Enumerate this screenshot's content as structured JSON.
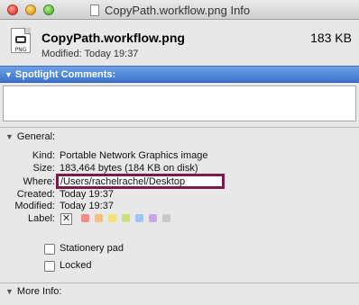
{
  "window": {
    "title": "CopyPath.workflow.png Info"
  },
  "file": {
    "name": "CopyPath.workflow.png",
    "size": "183 KB",
    "modified": "Modified: Today 19:37",
    "icon_label": "PNG"
  },
  "spotlight": {
    "header": "Spotlight Comments:"
  },
  "general": {
    "header": "General:",
    "kind_label": "Kind:",
    "kind_value": "Portable Network Graphics image",
    "size_label": "Size:",
    "size_value": "183,464 bytes (184 KB on disk)",
    "where_label": "Where:",
    "where_value": "/Users/rachelrachel/Desktop",
    "created_label": "Created:",
    "created_value": "Today 19:37",
    "modified_label": "Modified:",
    "modified_value": "Today 19:37",
    "label_label": "Label:",
    "label_none": "✕",
    "label_colors": [
      "#f28b8b",
      "#f5c07a",
      "#f2e27a",
      "#c8e27a",
      "#9ec6f2",
      "#c9a6e6",
      "#c8c8c8"
    ],
    "stationery_label": "Stationery pad",
    "locked_label": "Locked"
  },
  "more_info": {
    "header": "More Info:"
  }
}
